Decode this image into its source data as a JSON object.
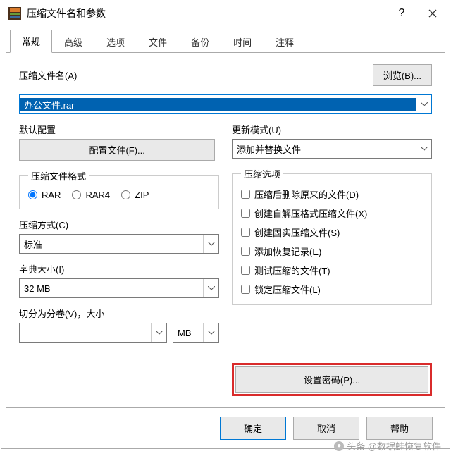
{
  "titlebar": {
    "title": "压缩文件名和参数"
  },
  "tabs": [
    "常规",
    "高级",
    "选项",
    "文件",
    "备份",
    "时间",
    "注释"
  ],
  "activeTab": 0,
  "browse": "浏览(B)...",
  "filenameLabel": "压缩文件名(A)",
  "filenameValue": "办公文件.rar",
  "defaultProfile": {
    "label": "默认配置",
    "button": "配置文件(F)..."
  },
  "updateMode": {
    "label": "更新模式(U)",
    "value": "添加并替换文件"
  },
  "formatGroup": {
    "legend": "压缩文件格式",
    "options": [
      "RAR",
      "RAR4",
      "ZIP"
    ],
    "selected": 0
  },
  "method": {
    "label": "压缩方式(C)",
    "value": "标准"
  },
  "dict": {
    "label": "字典大小(I)",
    "value": "32 MB"
  },
  "volume": {
    "label": "切分为分卷(V)，大小",
    "value": "",
    "unit": "MB"
  },
  "optionsGroup": {
    "legend": "压缩选项",
    "items": [
      "压缩后删除原来的文件(D)",
      "创建自解压格式压缩文件(X)",
      "创建固实压缩文件(S)",
      "添加恢复记录(E)",
      "测试压缩的文件(T)",
      "锁定压缩文件(L)"
    ]
  },
  "setPassword": "设置密码(P)...",
  "footer": {
    "ok": "确定",
    "cancel": "取消",
    "help": "帮助"
  },
  "watermark": "头条 @数据蛙恢复软件"
}
